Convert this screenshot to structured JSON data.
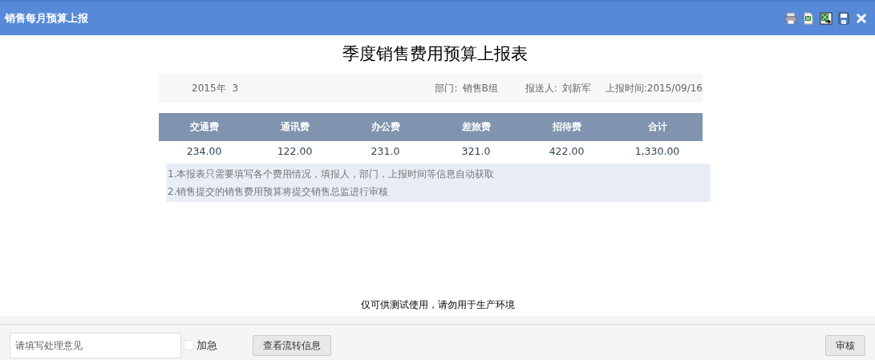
{
  "window": {
    "title": "销售每月预算上报"
  },
  "toolbar": [
    {
      "kind": "print"
    },
    {
      "kind": "excel"
    },
    {
      "kind": "export"
    },
    {
      "kind": "save"
    },
    {
      "kind": "close"
    }
  ],
  "report": {
    "title": "季度销售费用预算上报表",
    "period": {
      "year": "2015年",
      "month": "3"
    },
    "department": {
      "label": "部门:",
      "value": "销售B组"
    },
    "reporter": {
      "label": "报送人:",
      "value": "刘新军"
    },
    "report_time": "上报时间:2015/09/16",
    "table": {
      "columns": [
        "交通费",
        "通讯费",
        "办公费",
        "差旅费",
        "招待费",
        "合计"
      ],
      "rows": [
        [
          "234.00",
          "122.00",
          "231.0",
          "321.0",
          "422.00",
          "1,330.00"
        ]
      ]
    },
    "notes": [
      "1.本报表只需要填写各个费用情况，填报人，部门，上报时间等信息自动获取",
      "2.销售提交的销售费用预算将提交销售总监进行审核"
    ]
  },
  "notice": "仅可供测试使用，请勿用于生产环境",
  "footer": {
    "opinion": {
      "placeholder": "请填写处理意见"
    },
    "urgent": {
      "label": "加急",
      "checked": false
    },
    "history_button": "查看流转信息",
    "approve_button": "审核"
  }
}
